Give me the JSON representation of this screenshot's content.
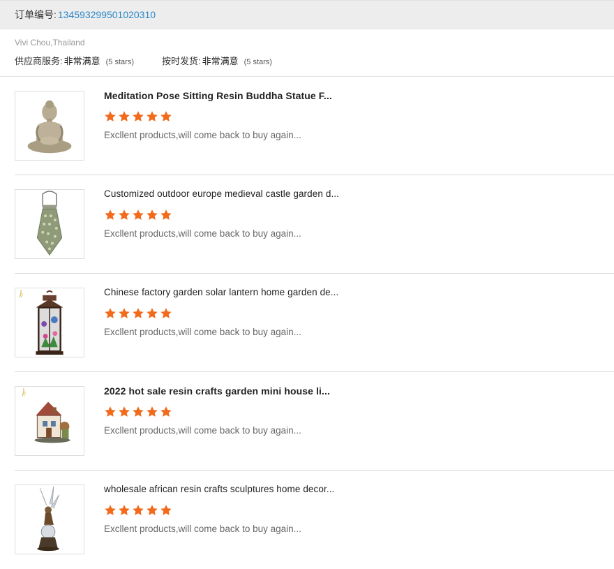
{
  "order": {
    "label": "订单编号:",
    "number": "134593299501020310"
  },
  "buyer": {
    "name": "Vivi Chou,Thailand",
    "ratings": [
      {
        "label": "供应商服务:",
        "value": "非常满意",
        "stars_text": "(5 stars)"
      },
      {
        "label": "按时发货:",
        "value": "非常满意",
        "stars_text": "(5 stars)"
      }
    ]
  },
  "reviews": [
    {
      "title": "Meditation Pose Sitting Resin Buddha Statue F...",
      "rating": 5,
      "comment": "Excllent products,will come back to buy again...",
      "image": "buddha-statue"
    },
    {
      "title": "Customized outdoor europe medieval castle garden d...",
      "rating": 5,
      "comment": "Excllent products,will come back to buy again...",
      "image": "hanging-lantern"
    },
    {
      "title": "Chinese factory garden solar lantern home garden de...",
      "rating": 5,
      "comment": "Excllent products,will come back to buy again...",
      "image": "solar-lantern"
    },
    {
      "title": "2022 hot sale resin crafts garden mini house li...",
      "rating": 5,
      "comment": "Excllent products,will come back to buy again...",
      "image": "mini-house"
    },
    {
      "title": "wholesale african resin crafts sculptures home decor...",
      "rating": 5,
      "comment": "Excllent products,will come back to buy again...",
      "image": "fairy-sculpture"
    }
  ],
  "colors": {
    "star": "#f26b1d",
    "order_number": "#2a86c8",
    "header_bg": "#ededed"
  }
}
